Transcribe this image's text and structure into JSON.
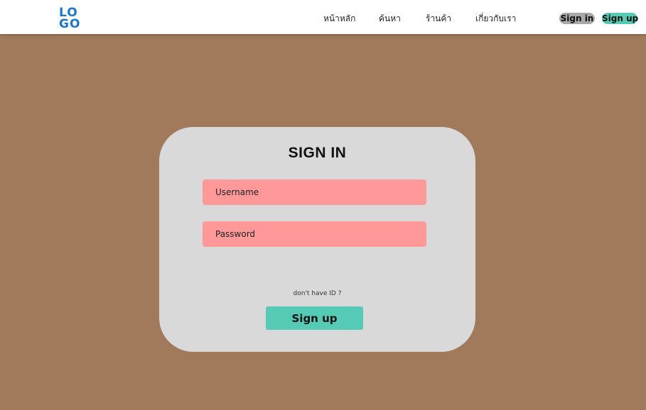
{
  "header": {
    "logo_line1": "LO",
    "logo_line2": "GO",
    "nav": [
      {
        "label": "หน้าหลัก"
      },
      {
        "label": "ค้นหา"
      },
      {
        "label": "ร้านค้า"
      },
      {
        "label": "เกี่ยวกับเรา"
      }
    ],
    "signin_label": "Sign in",
    "signup_label": "Sign up"
  },
  "card": {
    "title": "SIGN IN",
    "username_placeholder": "Username",
    "password_placeholder": "Password",
    "hint": "don't have  ID ?",
    "signup_button": "Sign up"
  },
  "colors": {
    "background": "#a17a5c",
    "card": "#d9d9d9",
    "input": "#ff9899",
    "accent": "#55cbb6",
    "logo": "#1976d2",
    "signin_pill": "#a8a8a8"
  }
}
